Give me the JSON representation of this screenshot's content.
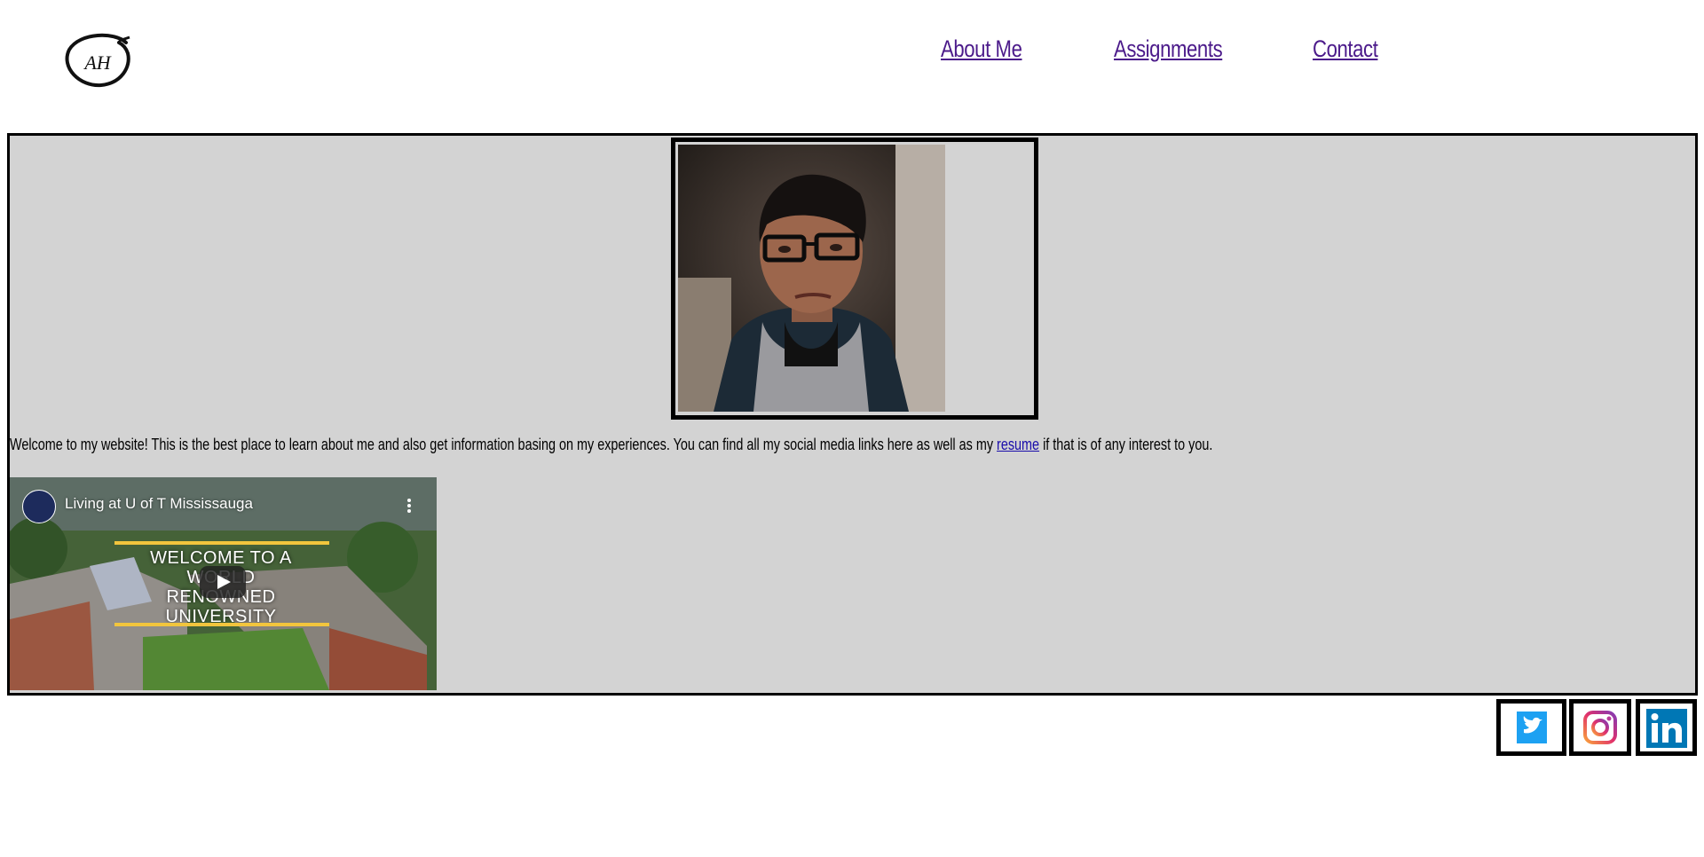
{
  "header": {
    "logo_text": "AH",
    "nav": [
      {
        "label": "About Me"
      },
      {
        "label": "Assignments"
      },
      {
        "label": "Contact"
      }
    ]
  },
  "main": {
    "intro_before": "Welcome to my website! This is the best place to learn about me and also get information basing on my experiences. You can find all my social media links here as well as my ",
    "intro_link": "resume",
    "intro_after": " if that is of any interest to you.",
    "video": {
      "title": "Living at U of T Mississauga",
      "banner_line1": "WELCOME TO A WORLD",
      "banner_line2": "RENOWNED UNIVERSITY"
    }
  },
  "social": [
    {
      "name": "twitter",
      "color": "#1da1f2"
    },
    {
      "name": "instagram",
      "color": "#c13584"
    },
    {
      "name": "linkedin",
      "color": "#0077b5"
    }
  ],
  "colors": {
    "nav_link": "#4b1a8a",
    "panel_bg": "#d3d3d3",
    "link": "#1a0dab"
  }
}
